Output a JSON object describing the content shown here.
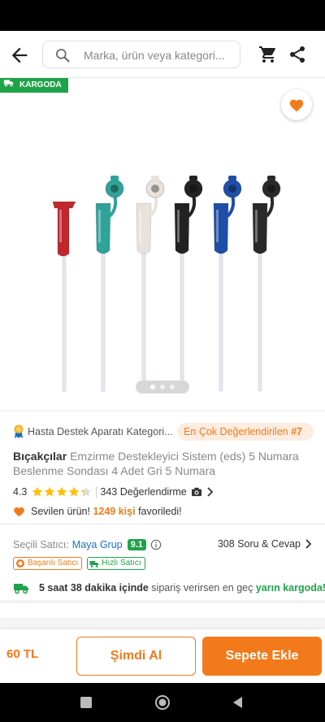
{
  "header": {
    "search_placeholder": "Marka, ürün veya kategori...",
    "icons": [
      "back-arrow-icon",
      "search-icon",
      "cart-icon",
      "share-icon"
    ]
  },
  "gallery": {
    "badge": "KARGODA",
    "image_count": 3,
    "active_index": 0,
    "product_colors": [
      "#c0282e",
      "#2fa39a",
      "#e9e2dc",
      "#222222",
      "#1e4fa8",
      "#2a2a2a"
    ]
  },
  "product": {
    "category": "Hasta Destek Aparatı Kategori...",
    "rank_text": "En Çok Değerlendirilen",
    "rank_num": "#7",
    "brand": "Bıçakçılar",
    "title": "Emzirme Destekleyici Sistem (eds) 5 Numara Beslenme Sondası 4 Adet Gri 5 Numara",
    "rating": "4.3",
    "rating_value": 4.3,
    "review_count": "343 Değerlendirme",
    "loved_prefix": "Sevilen ürün!",
    "loved_count": "1249 kişi",
    "loved_suffix": "favoriledi!"
  },
  "seller": {
    "label": "Seçili Satıcı:",
    "name": "Maya Grup",
    "score": "9.1",
    "qa": "308 Soru & Cevap",
    "tag1": "Başarılı Satıcı",
    "tag2": "Hızlı Satıcı",
    "delivery_time": "5 saat 38 dakika içinde",
    "delivery_mid": "sipariş verirsen en geç",
    "delivery_day": "yarın kargoda!"
  },
  "bottom": {
    "price": "60 TL",
    "buy_now": "Şimdi Al",
    "add_to_cart": "Sepete Ekle"
  },
  "colors": {
    "accent": "#f27a1a",
    "green": "#1fa34a",
    "link": "#1a71c4"
  }
}
